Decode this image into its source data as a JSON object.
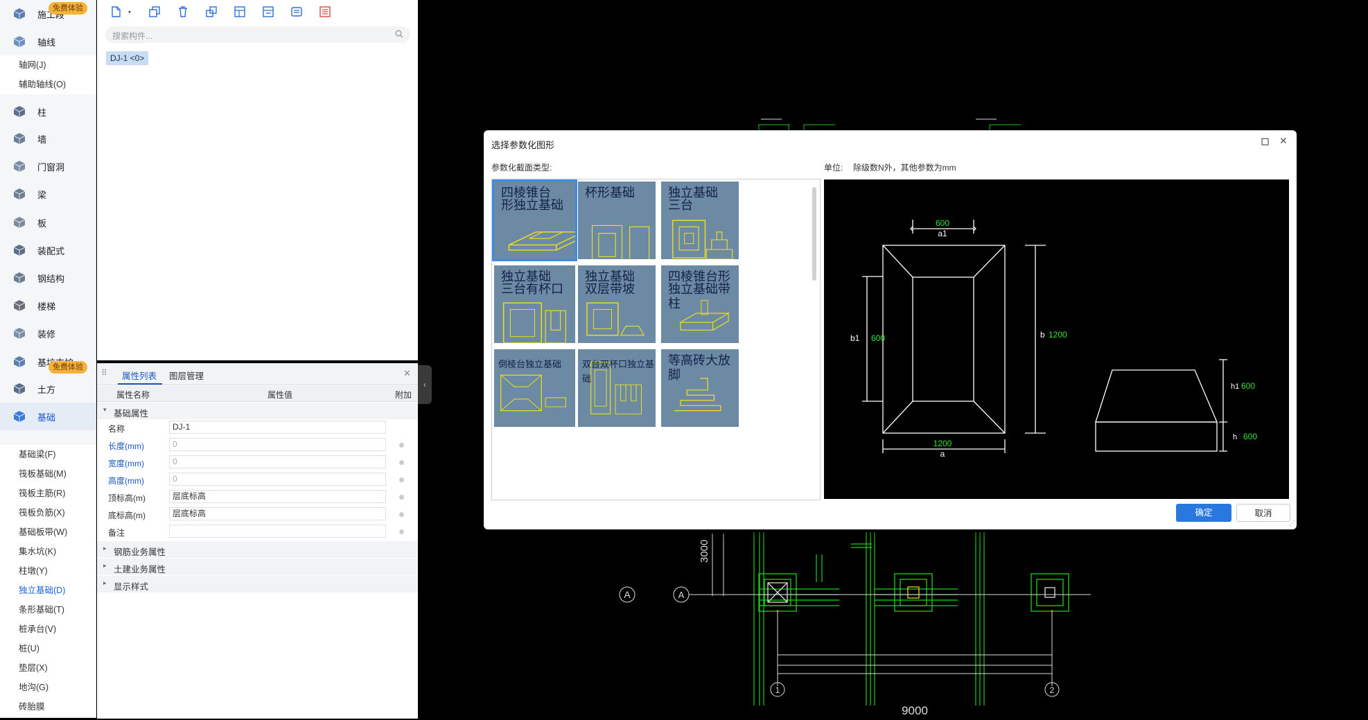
{
  "nav": {
    "badges": {
      "top": "免费体验",
      "foundation": "免费体验"
    },
    "categories": [
      {
        "label": "施工段",
        "icon": "construction-cube-icon"
      },
      {
        "label": "轴线",
        "icon": "grid-icon"
      },
      {
        "label": "柱",
        "icon": "column-icon"
      },
      {
        "label": "墙",
        "icon": "wall-icon"
      },
      {
        "label": "门窗洞",
        "icon": "door-window-icon"
      },
      {
        "label": "梁",
        "icon": "beam-icon"
      },
      {
        "label": "板",
        "icon": "slab-icon"
      },
      {
        "label": "装配式",
        "icon": "prefab-icon"
      },
      {
        "label": "钢结构",
        "icon": "steel-structure-icon"
      },
      {
        "label": "楼梯",
        "icon": "stair-icon"
      },
      {
        "label": "装修",
        "icon": "decoration-icon"
      },
      {
        "label": "基坑支护",
        "icon": "foundation-pit-icon"
      },
      {
        "label": "土方",
        "icon": "earthwork-icon"
      },
      {
        "label": "基础",
        "icon": "foundation-icon"
      }
    ],
    "axis_sub": [
      "轴网(J)",
      "辅助轴线(O)"
    ],
    "foundation_sub": [
      "基础梁(F)",
      "筏板基础(M)",
      "筏板主筋(R)",
      "筏板负筋(X)",
      "基础板带(W)",
      "集水坑(K)",
      "柱墩(Y)",
      "独立基础(D)",
      "条形基础(T)",
      "桩承台(V)",
      "桩(U)",
      "垫层(X)",
      "地沟(G)",
      "砖胎膜"
    ]
  },
  "component": {
    "search_placeholder": "搜索构件...",
    "tag": "DJ-1 <0>"
  },
  "props": {
    "tabs": [
      "属性列表",
      "图层管理"
    ],
    "headers": [
      "属性名称",
      "属性值",
      "附加"
    ],
    "group_basic": "基础属性",
    "rows": [
      {
        "name": "名称",
        "value": "DJ-1"
      },
      {
        "name": "长度(mm)",
        "value": "0"
      },
      {
        "name": "宽度(mm)",
        "value": "0"
      },
      {
        "name": "高度(mm)",
        "value": "0"
      },
      {
        "name": "顶标高(m)",
        "value": "层底标高"
      },
      {
        "name": "底标高(m)",
        "value": "层底标高"
      },
      {
        "name": "备注",
        "value": ""
      }
    ],
    "groups": [
      "钢筋业务属性",
      "土建业务属性",
      "显示样式"
    ]
  },
  "dialog": {
    "title": "选择参数化图形",
    "section_label": "参数化截面类型:",
    "unit_label": "单位:",
    "unit_text": "除级数N外，其他参数为mm",
    "shapes": [
      {
        "title": "四棱锥台形独立基础",
        "lines": [
          "四棱锥台",
          "形独立基础"
        ]
      },
      {
        "title": "杯形基础",
        "lines": [
          "杯形基础"
        ]
      },
      {
        "title": "独立基础三台",
        "lines": [
          "独立基础",
          "三台"
        ]
      },
      {
        "title": "独立基础三台有杯口",
        "lines": [
          "独立基础",
          "三台有杯口"
        ]
      },
      {
        "title": "独立基础双层带坡",
        "lines": [
          "独立基础",
          "双层带坡"
        ]
      },
      {
        "title": "四棱锥台形独立基础带柱",
        "lines": [
          "四棱锥台形",
          "独立基础带柱"
        ]
      },
      {
        "title": "倒棱台独立基础",
        "lines": [
          "倒棱台独立基础"
        ]
      },
      {
        "title": "双台双杯口独立基础",
        "lines": [
          "双台双杯口独立基础"
        ]
      },
      {
        "title": "等高砖大放脚",
        "lines": [
          "等高砖大放脚"
        ]
      }
    ],
    "preview": {
      "top_dim": "600",
      "top_label": "a1",
      "bottom_dim": "1200",
      "bottom_label": "a",
      "left_label": "b1",
      "left_dim": "600",
      "right_label": "b",
      "right_dim": "1200",
      "side_h1_label": "h1",
      "side_h1_dim": "600",
      "side_h_label": "h",
      "side_h_dim": "600"
    },
    "ok": "确定",
    "cancel": "取消"
  },
  "cad": {
    "axis_a": "A",
    "axis_1": "1",
    "axis_2": "2",
    "dim_3000": "3000",
    "dim_9000": "9000"
  }
}
